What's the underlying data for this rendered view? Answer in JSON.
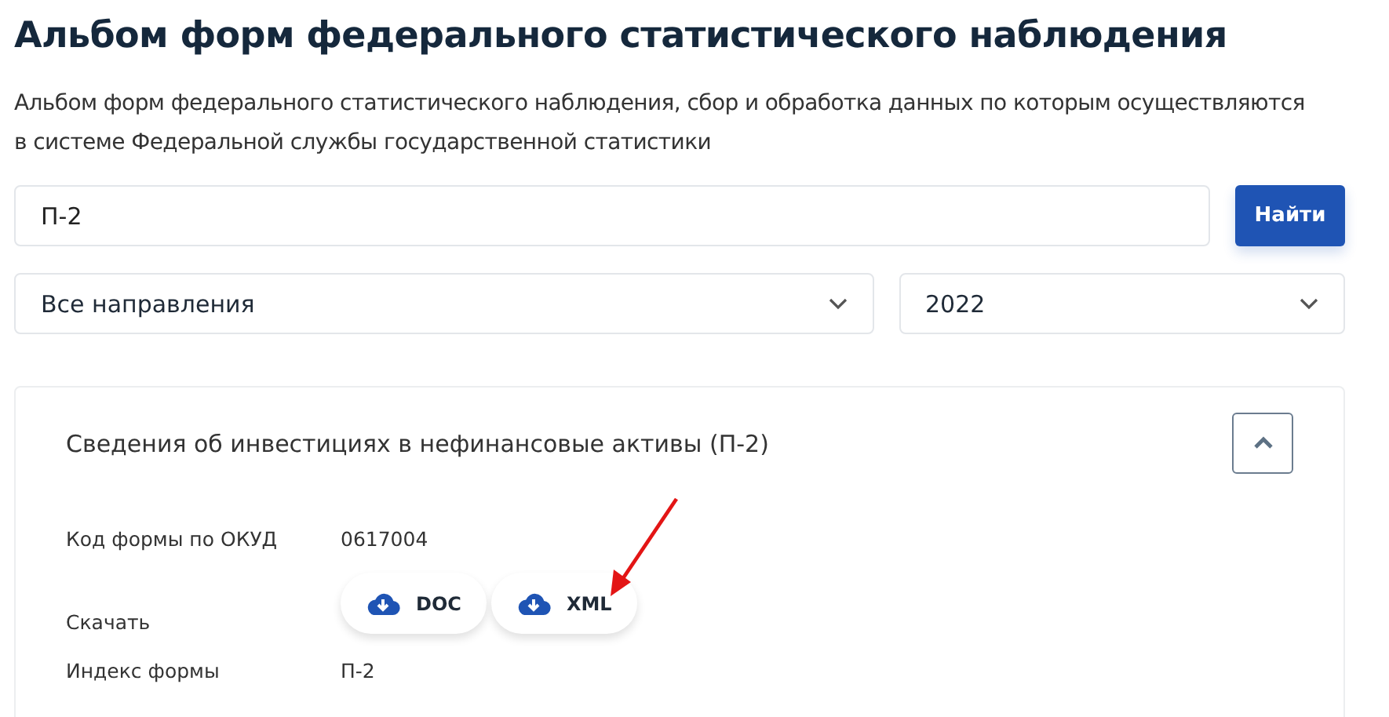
{
  "title": "Альбом форм федерального статистического наблюдения",
  "description": "Альбом форм федерального статистического наблюдения, сбор и обработка данных по которым осуществляются в системе Федеральной службы государственной статистики",
  "search": {
    "value": "П-2",
    "button": "Найти"
  },
  "filters": [
    {
      "value": "Все направления"
    },
    {
      "value": "2022"
    }
  ],
  "form_card": {
    "title": "Сведения об инвестициях в нефинансовые активы (П-2)",
    "expanded": true,
    "fields": [
      {
        "kind": "text",
        "label": "Код формы по ОКУД",
        "value": "0617004"
      },
      {
        "kind": "downloads",
        "label": "Скачать",
        "buttons": [
          "DOC",
          "XML"
        ]
      },
      {
        "kind": "text",
        "label": "Индекс формы",
        "value": "П-2"
      }
    ]
  },
  "annotation": {
    "kind": "arrow"
  }
}
